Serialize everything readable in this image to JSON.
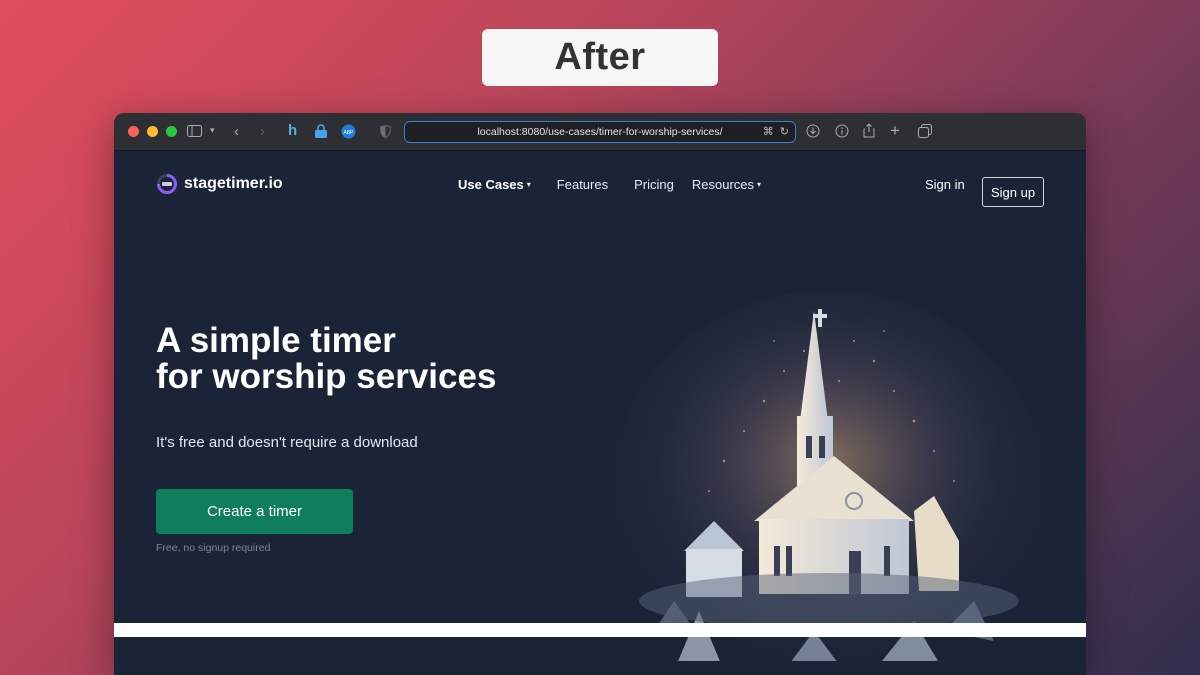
{
  "badge": {
    "label": "After"
  },
  "browser": {
    "url": "localhost:8080/use-cases/timer-for-worship-services/",
    "extension_badge": "ABP"
  },
  "site": {
    "logo_text": "stagetimer.io",
    "nav": [
      {
        "label": "Use Cases",
        "has_caret": true,
        "bold": true
      },
      {
        "label": "Features",
        "has_caret": false
      },
      {
        "label": "Pricing",
        "has_caret": false
      },
      {
        "label": "Resources",
        "has_caret": true
      }
    ],
    "sign_in": "Sign in",
    "sign_up": "Sign up"
  },
  "hero": {
    "title_line1": "A simple timer",
    "title_line2": "for worship services",
    "subtitle": "It's free and doesn't require a download",
    "cta": "Create a timer",
    "cta_note": "Free, no signup required"
  },
  "colors": {
    "page_bg": "#1b2437",
    "cta_bg": "#0f7e5b",
    "accent_logo": "#8b5cf6"
  }
}
